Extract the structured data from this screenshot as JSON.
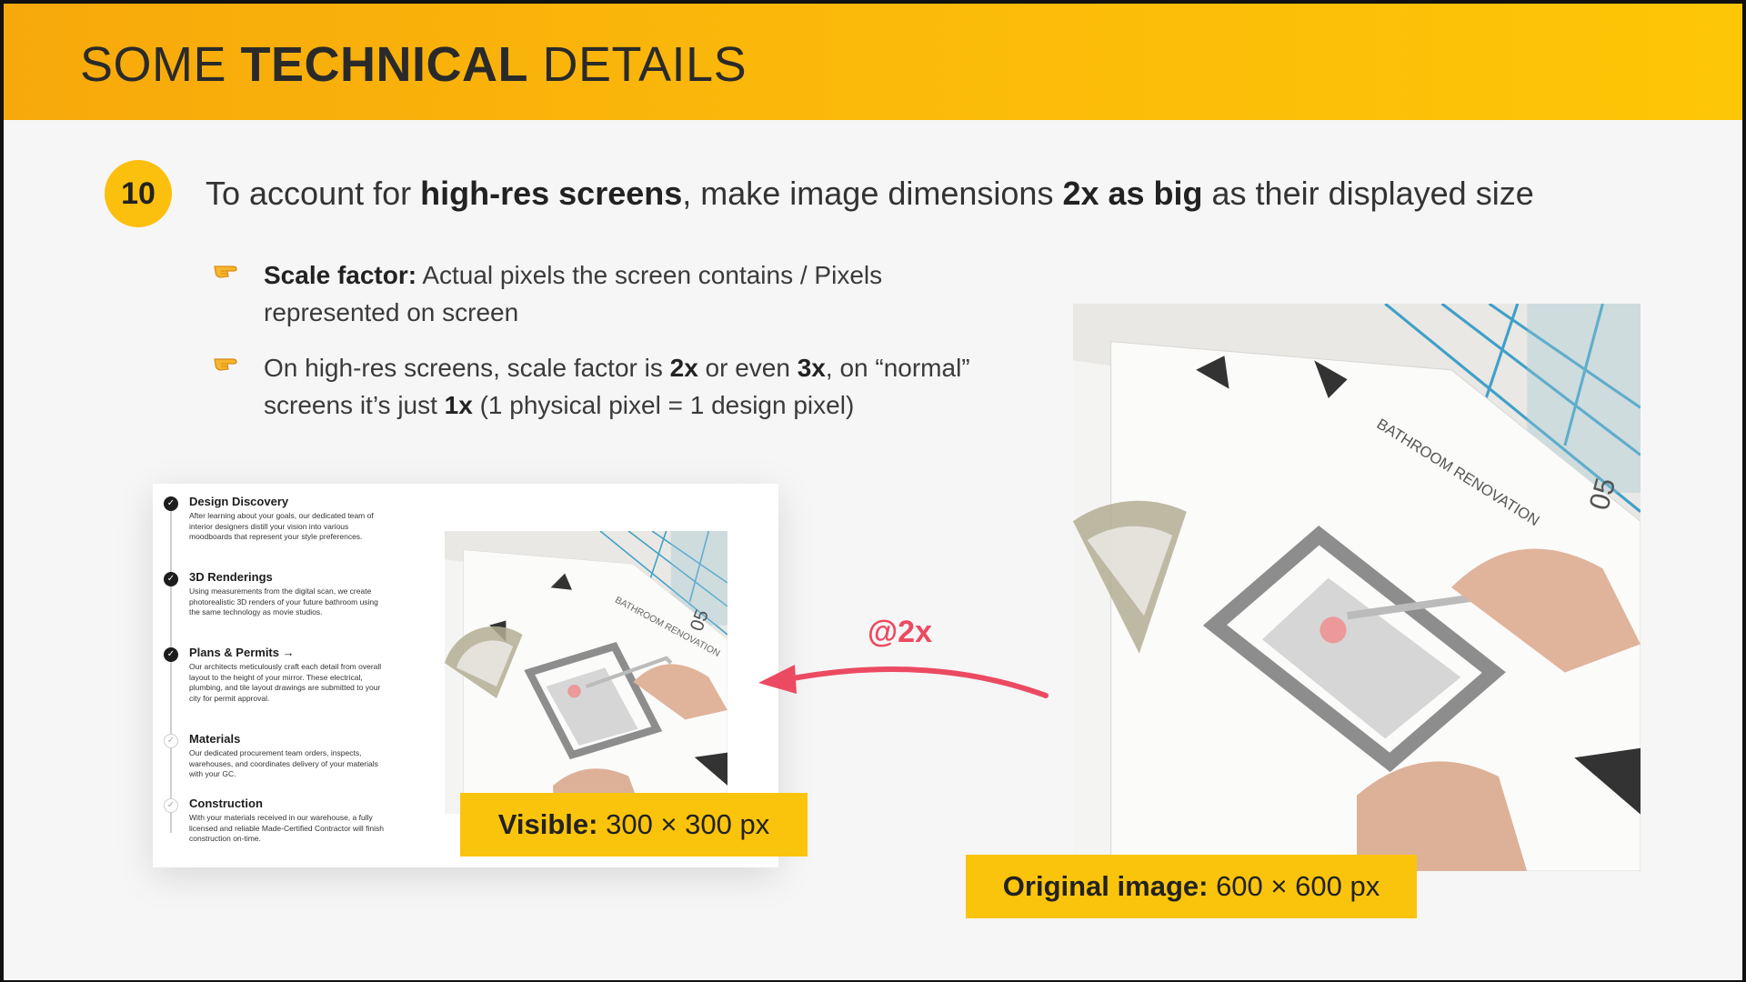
{
  "header": {
    "title_pre": "SOME ",
    "title_bold": "TECHNICAL",
    "title_post": " DETAILS"
  },
  "point": {
    "number": "10",
    "text_1": "To account for ",
    "bold_1": "high-res screens",
    "text_2": ", make image dimensions ",
    "bold_2": "2x as big",
    "text_3": " as their displayed size"
  },
  "bullets": [
    {
      "icon": "pointing-hand-icon",
      "bold": "Scale factor:",
      "line1": " Actual pixels the screen contains / Pixels",
      "line2": "represented on screen"
    },
    {
      "icon": "pointing-hand-icon",
      "l1a": "On high-res screens, scale factor is ",
      "l1b": "2x",
      "l1c": " or even ",
      "l1d": "3x",
      "l1e": ", on “normal”",
      "l2a": "screens it’s just ",
      "l2b": "1x",
      "l2c": " (1 physical pixel = 1 design pixel)"
    }
  ],
  "screenshot": {
    "steps": [
      {
        "title": "Design Discovery",
        "desc": "After learning about your goals, our dedicated team of interior designers distill your vision into various moodboards that represent your style preferences.",
        "done": true
      },
      {
        "title": "3D Renderings",
        "desc": "Using measurements from the digital scan, we create photorealistic 3D renders of your future bathroom using the same technology as movie studios.",
        "done": true
      },
      {
        "title": "Plans & Permits →",
        "desc": "Our architects meticulously craft each detail from overall layout to the height of your mirror. These electrical, plumbing, and tile layout drawings are submitted to your city for permit approval.",
        "done": true
      },
      {
        "title": "Materials",
        "desc": "Our dedicated procurement team orders, inspects, warehouses, and coordinates delivery of your materials with your GC.",
        "done": false
      },
      {
        "title": "Construction",
        "desc": "With your materials received in our warehouse, a fully licensed and reliable Made-Certified Contractor will finish construction on-time.",
        "done": false
      }
    ]
  },
  "visible_label": {
    "bold": "Visible:",
    "text": " 300 × 300 px"
  },
  "original_label": {
    "bold": "Original image:",
    "text": " 600 × 600 px"
  },
  "arrow": {
    "label": "@2x",
    "color": "#ec4a62"
  },
  "drawing": {
    "sheet_title": "BATHROOM RENOVATION",
    "sheet_number": "05"
  },
  "colors": {
    "accent": "#fbc40c",
    "header_start": "#f7a90b",
    "arrow": "#ec4a62"
  }
}
